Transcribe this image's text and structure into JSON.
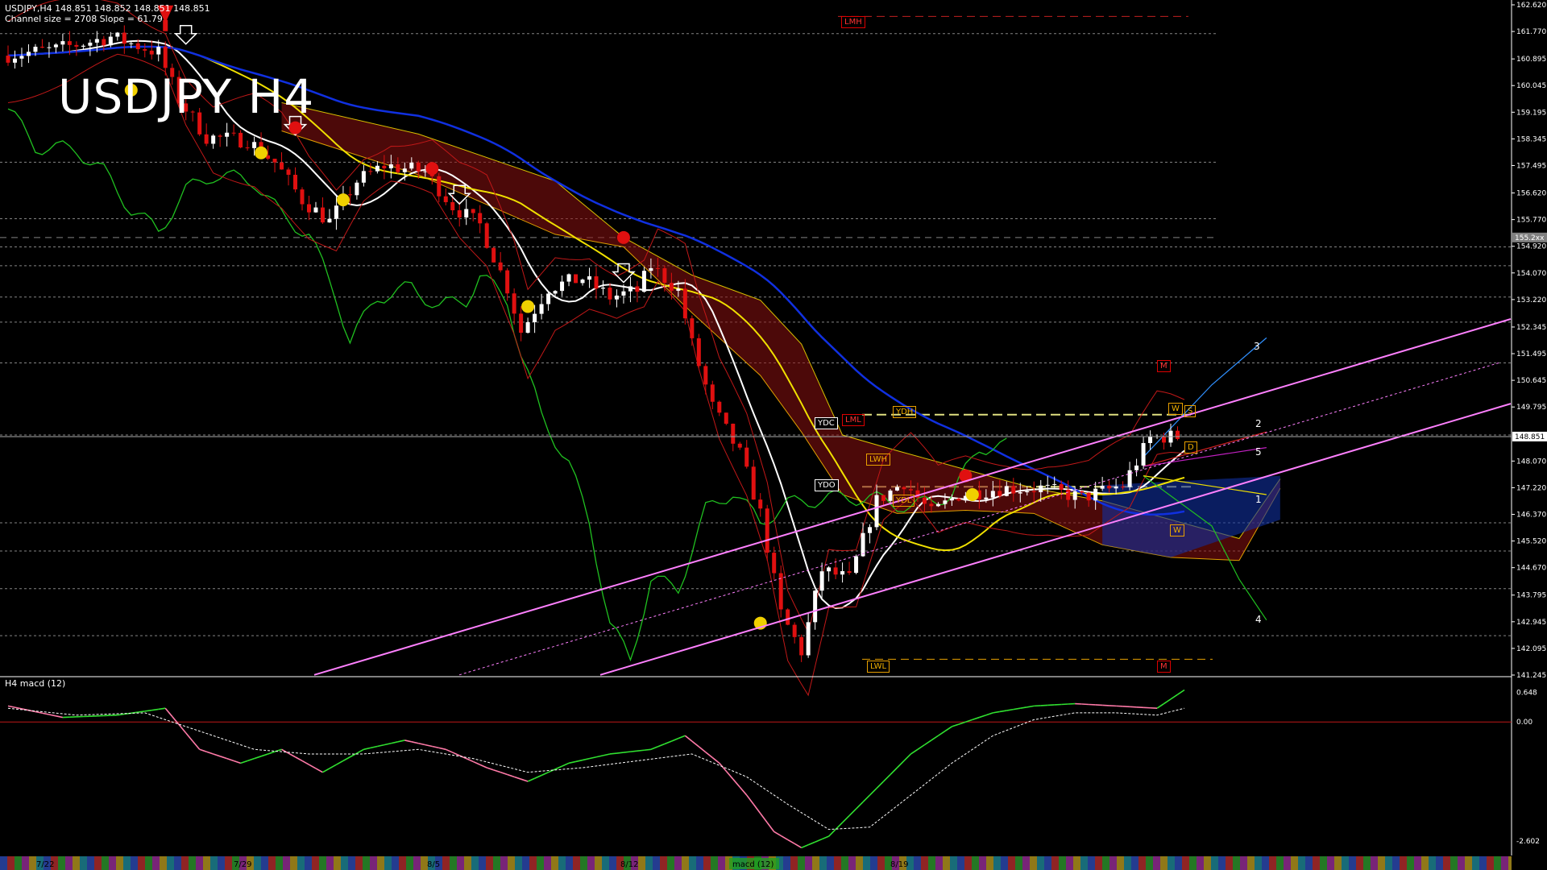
{
  "header": {
    "line1": "USDJPY,H4  148.851 148.852 148.851 148.851",
    "line2": "Channel size = 2708 Slope = 61.79"
  },
  "title": "USDJPY H4",
  "colors": {
    "bull": "#ffffff",
    "bear": "#e01010",
    "ma_white": "#ffffff",
    "ma_yellow": "#f0e000",
    "ma_blue": "#1030e0",
    "ichimoku_line": "#20c020",
    "cloud": "#c02020",
    "channel": "#ff80ff",
    "orange": "#e8a000",
    "grid_dash": "#b0b0b0"
  },
  "chart_data": {
    "type": "candlestick",
    "symbol": "USDJPY",
    "timeframe": "H4",
    "last_price": 148.851,
    "ylim": [
      141.245,
      162.62
    ],
    "y_ticks": [
      "162.620",
      "161.770",
      "160.895",
      "160.045",
      "159.195",
      "158.345",
      "157.495",
      "156.620",
      "155.770",
      "154.920",
      "154.070",
      "153.220",
      "152.345",
      "151.495",
      "150.645",
      "149.795",
      "148.070",
      "147.220",
      "146.370",
      "145.520",
      "144.670",
      "143.795",
      "142.945",
      "142.095",
      "141.245"
    ],
    "highlight_ticks": [
      "155.2xx",
      "148.851"
    ],
    "x_dates": [
      "7/22",
      "7/29",
      "8/5",
      "8/12",
      "8/19"
    ],
    "price_path": [
      [
        0,
        161.0
      ],
      [
        8,
        161.2
      ],
      [
        16,
        161.6
      ],
      [
        23,
        161.1
      ],
      [
        26,
        159.6
      ],
      [
        30,
        158.4
      ],
      [
        36,
        158.3
      ],
      [
        40,
        157.6
      ],
      [
        44,
        156.4
      ],
      [
        48,
        155.7
      ],
      [
        52,
        157.0
      ],
      [
        56,
        157.5
      ],
      [
        62,
        157.3
      ],
      [
        66,
        156.2
      ],
      [
        70,
        155.6
      ],
      [
        74,
        153.6
      ],
      [
        76,
        152.2
      ],
      [
        80,
        153.6
      ],
      [
        85,
        153.9
      ],
      [
        89,
        153.3
      ],
      [
        93,
        153.5
      ],
      [
        95,
        154.3
      ],
      [
        99,
        153.5
      ],
      [
        101,
        151.8
      ],
      [
        104,
        149.8
      ],
      [
        108,
        148.3
      ],
      [
        111,
        146.4
      ],
      [
        114,
        143.2
      ],
      [
        117,
        142.0
      ],
      [
        120,
        144.6
      ],
      [
        124,
        144.3
      ],
      [
        128,
        146.8
      ],
      [
        132,
        147.4
      ],
      [
        136,
        146.4
      ],
      [
        140,
        147.0
      ],
      [
        146,
        147.2
      ],
      [
        152,
        147.2
      ],
      [
        158,
        146.9
      ],
      [
        164,
        147.3
      ],
      [
        168,
        148.8
      ],
      [
        170,
        148.85
      ]
    ],
    "macd": {
      "label": "H4 macd (12)",
      "ticks": [
        "0.648",
        "0.00",
        "-2.602"
      ],
      "ylim": [
        -2.85,
        0.85
      ],
      "main": [
        [
          0,
          0.35
        ],
        [
          8,
          0.1
        ],
        [
          16,
          0.15
        ],
        [
          23,
          0.3
        ],
        [
          28,
          -0.6
        ],
        [
          34,
          -0.9
        ],
        [
          40,
          -0.6
        ],
        [
          46,
          -1.1
        ],
        [
          52,
          -0.6
        ],
        [
          58,
          -0.4
        ],
        [
          64,
          -0.6
        ],
        [
          70,
          -1.0
        ],
        [
          76,
          -1.3
        ],
        [
          82,
          -0.9
        ],
        [
          88,
          -0.7
        ],
        [
          94,
          -0.6
        ],
        [
          99,
          -0.3
        ],
        [
          104,
          -0.9
        ],
        [
          108,
          -1.6
        ],
        [
          112,
          -2.4
        ],
        [
          116,
          -2.75
        ],
        [
          120,
          -2.5
        ],
        [
          126,
          -1.6
        ],
        [
          132,
          -0.7
        ],
        [
          138,
          -0.1
        ],
        [
          144,
          0.2
        ],
        [
          150,
          0.35
        ],
        [
          156,
          0.4
        ],
        [
          162,
          0.35
        ],
        [
          168,
          0.3
        ],
        [
          172,
          0.7
        ]
      ],
      "signal": [
        [
          0,
          0.3
        ],
        [
          10,
          0.15
        ],
        [
          20,
          0.2
        ],
        [
          28,
          -0.2
        ],
        [
          36,
          -0.6
        ],
        [
          44,
          -0.7
        ],
        [
          52,
          -0.7
        ],
        [
          60,
          -0.6
        ],
        [
          68,
          -0.8
        ],
        [
          76,
          -1.1
        ],
        [
          84,
          -1.0
        ],
        [
          92,
          -0.85
        ],
        [
          100,
          -0.7
        ],
        [
          108,
          -1.2
        ],
        [
          114,
          -1.8
        ],
        [
          120,
          -2.35
        ],
        [
          126,
          -2.3
        ],
        [
          132,
          -1.6
        ],
        [
          138,
          -0.9
        ],
        [
          144,
          -0.3
        ],
        [
          150,
          0.05
        ],
        [
          156,
          0.2
        ],
        [
          162,
          0.2
        ],
        [
          168,
          0.15
        ],
        [
          172,
          0.3
        ]
      ]
    },
    "annotations": {
      "boxes": [
        "LMH",
        "LML",
        "LWH",
        "LWL",
        "YDH",
        "YDL",
        "YDC",
        "YDO",
        "M",
        "M",
        "M",
        "W",
        "S",
        "D",
        "W"
      ],
      "wave_labels": [
        "3",
        "2",
        "5",
        "1",
        "4"
      ],
      "indicator_label": "macd (12)"
    }
  }
}
